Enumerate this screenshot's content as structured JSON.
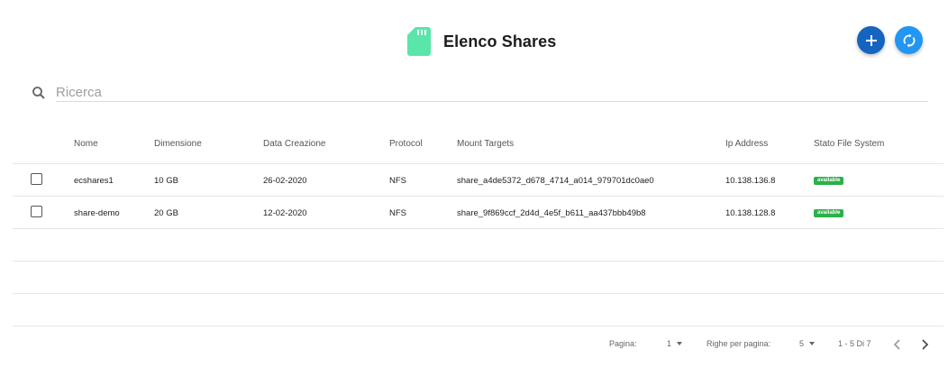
{
  "header": {
    "title": "Elenco Shares",
    "icon": "sd-card-icon",
    "accent": "#5ae5a9",
    "add_color": "#1565c0",
    "refresh_color": "#2196f3"
  },
  "search": {
    "placeholder": "Ricerca",
    "value": ""
  },
  "table": {
    "columns": [
      "Nome",
      "Dimensione",
      "Data Creazione",
      "Protocol",
      "Mount Targets",
      "Ip Address",
      "Stato File System"
    ],
    "rows": [
      {
        "name": "ecshares1",
        "size": "10 GB",
        "date": "26-02-2020",
        "protocol": "NFS",
        "mount": "share_a4de5372_d678_4714_a014_979701dc0ae0",
        "ip": "10.138.136.8",
        "status": "available"
      },
      {
        "name": "share-demo",
        "size": "20 GB",
        "date": "12-02-2020",
        "protocol": "NFS",
        "mount": "share_9f869ccf_2d4d_4e5f_b611_aa437bbb49b8",
        "ip": "10.138.128.8",
        "status": "available"
      }
    ],
    "status_color": "#2bb04a"
  },
  "pagination": {
    "page_label": "Pagina:",
    "page_value": "1",
    "rows_label": "Righe per pagina:",
    "rows_value": "5",
    "range": "1 - 5 Di 7"
  }
}
